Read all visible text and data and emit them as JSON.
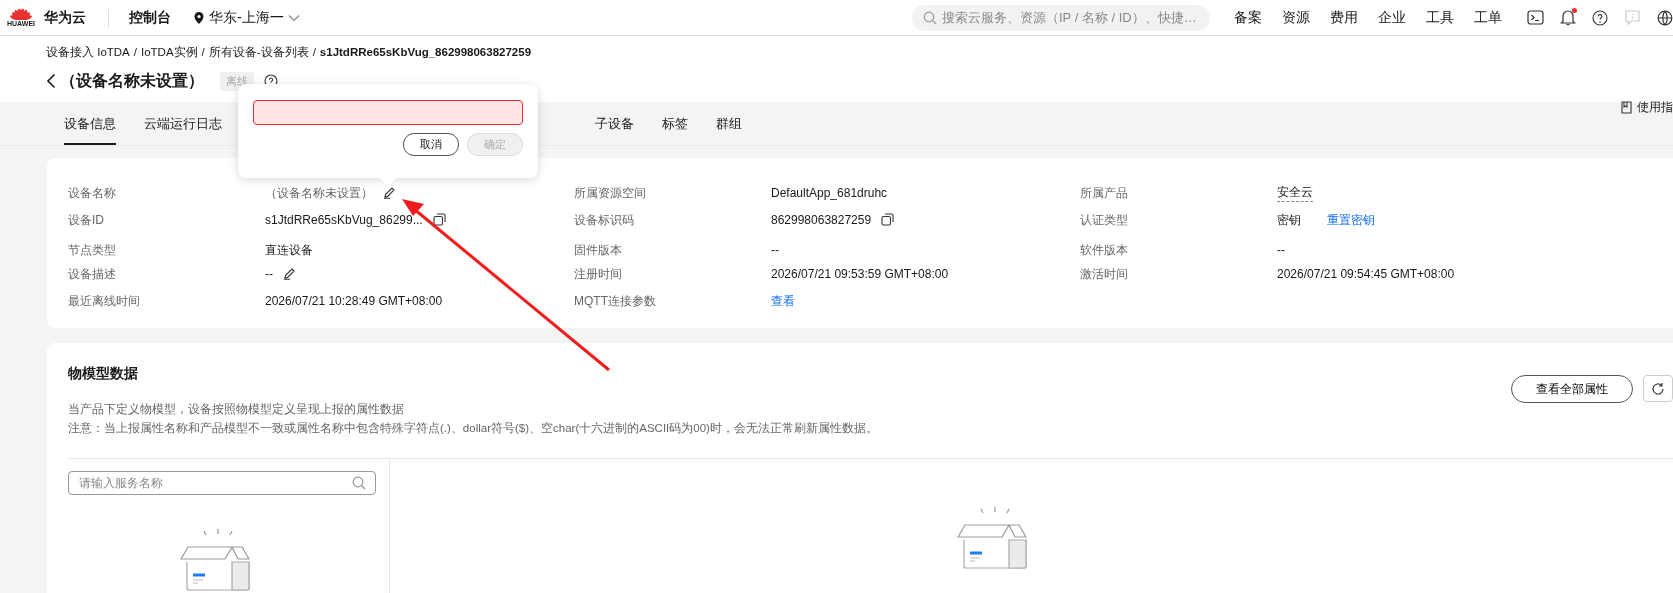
{
  "topbar": {
    "logo_caption": "HUAWEI",
    "brand": "华为云",
    "console": "控制台",
    "region": "华东-上海一",
    "search": {
      "placeholder": "搜索云服务、资源（IP / 名称 / ID）、快捷…"
    },
    "nav": [
      "备案",
      "资源",
      "费用",
      "企业",
      "工具",
      "工单"
    ],
    "notifications_unread": true
  },
  "breadcrumb_separator": "/",
  "breadcrumb": [
    "设备接入 IoTDA",
    "IoTDA实例",
    "所有设备-设备列表",
    "s1JtdRRe65sKbVug_862998063827259"
  ],
  "page_title": "（设备名称未设置）",
  "status": "离线",
  "guide_link": "使用指",
  "tabs": [
    {
      "label": "设备信息",
      "selected": true
    },
    {
      "label": "云端运行日志",
      "selected": false
    },
    {
      "label": "子设备",
      "selected": false
    },
    {
      "label": "标签",
      "selected": false
    },
    {
      "label": "群组",
      "selected": false
    }
  ],
  "device_info": [
    {
      "label": "设备名称",
      "value": "（设备名称未设置）",
      "kind": "muted",
      "editable": true
    },
    {
      "label": "所属资源空间",
      "value": "DefaultApp_681druhc",
      "kind": "text"
    },
    {
      "label": "所属产品",
      "value": "安全云",
      "kind": "dashed"
    },
    {
      "label": "设备ID",
      "value": "s1JtdRRe65sKbVug_86299...",
      "kind": "text",
      "copyable": true
    },
    {
      "label": "设备标识码",
      "value": "862998063827259",
      "kind": "text",
      "copyable": true
    },
    {
      "label": "认证类型",
      "value": "密钥",
      "kind": "text",
      "link": "重置密钥"
    },
    {
      "label": "节点类型",
      "value": "直连设备",
      "kind": "text"
    },
    {
      "label": "固件版本",
      "value": "--",
      "kind": "text"
    },
    {
      "label": "软件版本",
      "value": "--",
      "kind": "text"
    },
    {
      "label": "设备描述",
      "value": "--",
      "kind": "text",
      "editable": true
    },
    {
      "label": "注册时间",
      "value": "2026/07/21 09:53:59 GMT+08:00",
      "kind": "text"
    },
    {
      "label": "激活时间",
      "value": "2026/07/21 09:54:45 GMT+08:00",
      "kind": "text"
    },
    {
      "label": "最近离线时间",
      "value": "2026/07/21 10:28:49 GMT+08:00",
      "kind": "text"
    },
    {
      "label": "MQTT连接参数",
      "value": "查看",
      "kind": "link"
    }
  ],
  "model_data": {
    "title": "物模型数据",
    "notes": [
      "当产品下定义物模型，设备按照物模型定义呈现上报的属性数据",
      "注意：当上报属性名称和产品模型不一致或属性名称中包含特殊字符点(.)、dollar符号($)、空char(十六进制的ASCII码为00)时，会无法正常刷新属性数据。"
    ],
    "view_all_button": "查看全部属性",
    "service_search": {
      "placeholder": "请输入服务名称"
    }
  },
  "edit_popover": {
    "name_field": {
      "invalid": true
    },
    "buttons": [
      {
        "label": "取消",
        "disabled": false
      },
      {
        "label": "确定",
        "disabled": true
      }
    ]
  }
}
